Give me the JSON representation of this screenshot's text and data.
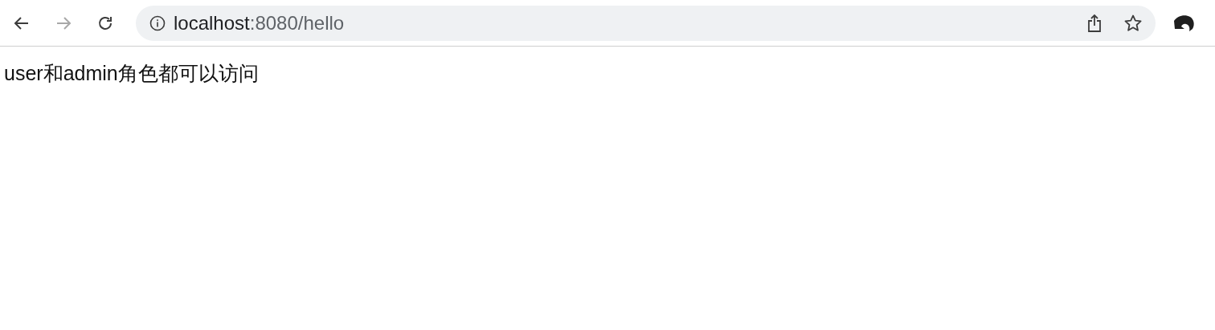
{
  "toolbar": {
    "back": {
      "disabled": false
    },
    "forward": {
      "disabled": true
    },
    "address": {
      "host": "localhost",
      "path": ":8080/hello"
    }
  },
  "page": {
    "text": "user和admin角色都可以访问"
  }
}
